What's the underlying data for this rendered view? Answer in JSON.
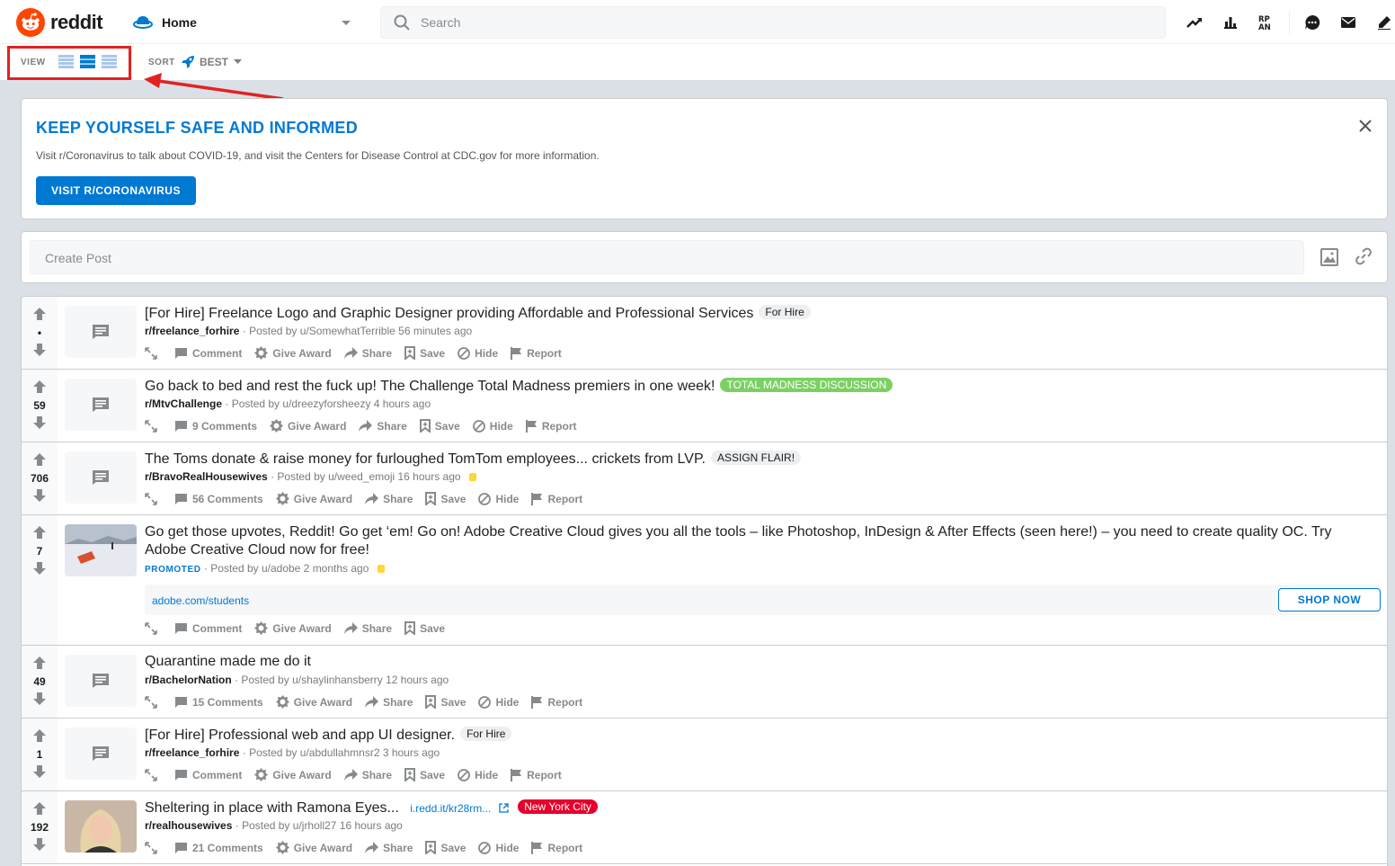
{
  "header": {
    "logo_text": "reddit",
    "home_label": "Home",
    "search_placeholder": "Search",
    "icons": [
      "trending-icon",
      "stats-icon",
      "rpan-icon",
      "chat-icon",
      "mail-icon",
      "create-post-icon"
    ]
  },
  "subbar": {
    "view_label": "VIEW",
    "sort_label": "SORT",
    "sort_value": "BEST"
  },
  "banner": {
    "title": "KEEP YOURSELF SAFE AND INFORMED",
    "description": "Visit r/Coronavirus to talk about COVID-19, and visit the Centers for Disease Control at CDC.gov for more information.",
    "button": "VISIT R/CORONAVIRUS"
  },
  "create_post": {
    "placeholder": "Create Post"
  },
  "posts": [
    {
      "score": "•",
      "title": "[For Hire] Freelance Logo and Graphic Designer providing Affordable and Professional Services",
      "flair": "For Hire",
      "subreddit": "r/freelance_forhire",
      "posted": "· Posted by u/SomewhatTerrible 56 minutes ago",
      "comments": "Comment"
    },
    {
      "score": "59",
      "title": "Go back to bed and rest the fuck up! The Challenge Total Madness premiers in one week!",
      "flair": "TOTAL MADNESS DISCUSSION",
      "subreddit": "r/MtvChallenge",
      "posted": "· Posted by u/dreezyforsheezy 4 hours ago",
      "comments": "9 Comments"
    },
    {
      "score": "706",
      "title": "The Toms donate & raise money for furloughed TomTom employees... crickets from LVP.",
      "flair": "ASSIGN FLAIR!",
      "subreddit": "r/BravoRealHousewives",
      "posted": "· Posted by u/weed_emoji 16 hours ago",
      "comments": "56 Comments"
    },
    {
      "score": "7",
      "title": "Go get those upvotes, Reddit! Go get ‘em! Go on! Adobe Creative Cloud gives you all the tools – like Photoshop, InDesign & After Effects (seen here!) – you need to create quality OC. Try Adobe Creative Cloud now for free!",
      "promoted": "PROMOTED",
      "posted": "· Posted by u/adobe 2 months ago",
      "link": "adobe.com/students",
      "cta": "SHOP NOW",
      "comments": "Comment"
    },
    {
      "score": "49",
      "title": "Quarantine made me do it",
      "subreddit": "r/BachelorNation",
      "posted": "· Posted by u/shaylinhansberry 12 hours ago",
      "comments": "15 Comments"
    },
    {
      "score": "1",
      "title": "[For Hire] Professional web and app UI designer.",
      "flair": "For Hire",
      "subreddit": "r/freelance_forhire",
      "posted": "· Posted by u/abdullahmnsr2 3 hours ago",
      "comments": "Comment"
    },
    {
      "score": "192",
      "title": "Sheltering in place with Ramona Eyes...",
      "domain": "i.redd.it/kr28rm...",
      "flair": "New York City",
      "subreddit": "r/realhousewives",
      "posted": "· Posted by u/jrholl27 16 hours ago",
      "comments": "21 Comments"
    }
  ],
  "actions": {
    "award": "Give Award",
    "share": "Share",
    "save": "Save",
    "hide": "Hide",
    "report": "Report"
  },
  "colors": {
    "brand": "#ff4500",
    "accent": "#0079d3",
    "flair_green": "#7bd062",
    "flair_red": "#e4002b",
    "highlight": "#e22222"
  }
}
